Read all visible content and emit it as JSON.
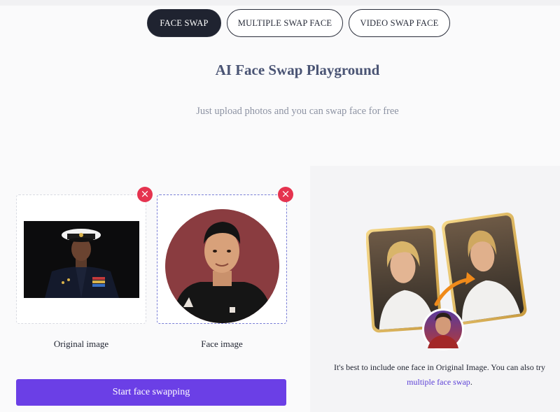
{
  "tabs": [
    {
      "label": "FACE SWAP",
      "active": true
    },
    {
      "label": "MULTIPLE SWAP FACE",
      "active": false
    },
    {
      "label": "VIDEO SWAP FACE",
      "active": false
    }
  ],
  "header": {
    "title": "AI Face Swap Playground",
    "subtitle": "Just upload photos and you can swap face for free"
  },
  "upload": {
    "original_caption": "Original image",
    "face_caption": "Face image",
    "remove_icon": "close-icon",
    "remove_symbol": "×"
  },
  "actions": {
    "start_label": "Start face swapping"
  },
  "tip": {
    "text": "It's best to include one face in Original Image. You can also try",
    "link_text": "multiple face swap",
    "suffix": "."
  },
  "colors": {
    "accent": "#6b3fe6",
    "remove": "#e5334f",
    "tab_active": "#1f2330",
    "title": "#4a5474"
  }
}
